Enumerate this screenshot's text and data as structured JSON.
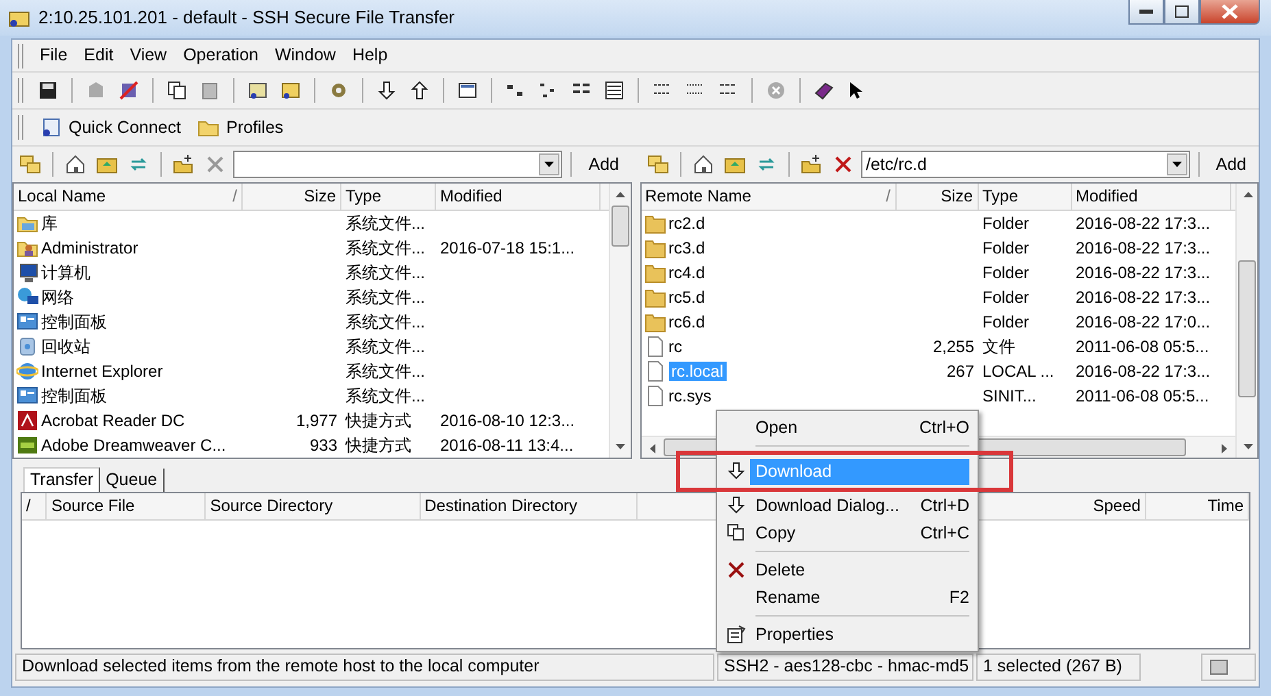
{
  "window": {
    "title": "2:10.25.101.201 - default - SSH Secure File Transfer"
  },
  "menu": [
    "File",
    "Edit",
    "View",
    "Operation",
    "Window",
    "Help"
  ],
  "quick_bar": [
    {
      "label": "Quick Connect",
      "kind": "connect"
    },
    {
      "label": "Profiles",
      "kind": "folder"
    }
  ],
  "local": {
    "add_button": "Add",
    "sort_mark": "/",
    "columns": [
      "Local Name",
      "Size",
      "Type",
      "Modified"
    ],
    "rows": [
      {
        "kind": "library",
        "name": "库",
        "type": "系统文件...",
        "selected": false
      },
      {
        "kind": "user",
        "name": "Administrator",
        "type": "系统文件...",
        "modified": "2016-07-18 15:1...",
        "selected": false
      },
      {
        "kind": "computer",
        "name": "计算机",
        "type": "系统文件...",
        "selected": false
      },
      {
        "kind": "network",
        "name": "网络",
        "type": "系统文件...",
        "selected": false
      },
      {
        "kind": "panel",
        "name": "控制面板",
        "type": "系统文件...",
        "selected": false
      },
      {
        "kind": "recycle",
        "name": "回收站",
        "type": "系统文件...",
        "selected": false
      },
      {
        "kind": "browser",
        "name": "Internet Explorer",
        "type": "系统文件...",
        "selected": false
      },
      {
        "kind": "panel",
        "name": "控制面板",
        "type": "系统文件...",
        "selected": false
      },
      {
        "kind": "pdf",
        "name": "Acrobat Reader DC",
        "size": "1,977",
        "type": "快捷方式",
        "modified": "2016-08-10 12:3...",
        "selected": false
      },
      {
        "kind": "dw",
        "name": "Adobe Dreamweaver C...",
        "size": "933",
        "type": "快捷方式",
        "modified": "2016-08-11 13:4...",
        "selected": false
      }
    ]
  },
  "remote": {
    "path": "/etc/rc.d",
    "add_button": "Add",
    "sort_mark": "/",
    "columns": [
      "Remote Name",
      "Size",
      "Type",
      "Modified"
    ],
    "rows": [
      {
        "kind": "folder",
        "name": "rc2.d",
        "type": "Folder",
        "modified": "2016-08-22 17:3...",
        "selected": false
      },
      {
        "kind": "folder",
        "name": "rc3.d",
        "type": "Folder",
        "modified": "2016-08-22 17:3...",
        "selected": false
      },
      {
        "kind": "folder",
        "name": "rc4.d",
        "type": "Folder",
        "modified": "2016-08-22 17:3...",
        "selected": false
      },
      {
        "kind": "folder",
        "name": "rc5.d",
        "type": "Folder",
        "modified": "2016-08-22 17:3...",
        "selected": false
      },
      {
        "kind": "folder",
        "name": "rc6.d",
        "type": "Folder",
        "modified": "2016-08-22 17:0...",
        "selected": false
      },
      {
        "kind": "file",
        "name": "rc",
        "size": "2,255",
        "type": "文件",
        "modified": "2011-06-08 05:5...",
        "selected": false
      },
      {
        "kind": "file",
        "name": "rc.local",
        "size": "267",
        "type": "LOCAL ...",
        "modified": "2016-08-22 17:3...",
        "selected": true
      },
      {
        "kind": "file",
        "name": "rc.sys",
        "type": "SINIT...",
        "modified": "2011-06-08 05:5...",
        "selected": false
      }
    ]
  },
  "context_menu": [
    {
      "kind": "plain",
      "label": "Open",
      "shortcut": "Ctrl+O",
      "selected": false,
      "outlined": false
    },
    {
      "kind": "separator"
    },
    {
      "kind": "arrow",
      "label": "Download",
      "selected": true,
      "outlined": true
    },
    {
      "kind": "arrow",
      "label": "Download Dialog...",
      "shortcut": "Ctrl+D",
      "selected": false,
      "outlined": false
    },
    {
      "kind": "copy",
      "label": "Copy",
      "shortcut": "Ctrl+C",
      "selected": false,
      "outlined": false
    },
    {
      "kind": "separator"
    },
    {
      "kind": "delete",
      "label": "Delete",
      "selected": false,
      "outlined": false
    },
    {
      "kind": "plain",
      "label": "Rename",
      "shortcut": "F2",
      "selected": false,
      "outlined": false
    },
    {
      "kind": "separator"
    },
    {
      "kind": "properties",
      "label": "Properties",
      "selected": false,
      "outlined": false
    }
  ],
  "transfer": {
    "tabs": [
      {
        "label": "Transfer",
        "selected": true
      },
      {
        "label": "Queue",
        "selected": false
      }
    ],
    "columns": [
      "/",
      "Source File",
      "Source Directory",
      "Destination Directory",
      "Speed",
      "Time"
    ]
  },
  "status_bar": {
    "message": "Download selected items from the remote host to the local computer",
    "connection": "SSH2 - aes128-cbc - hmac-md5",
    "selection": "1 selected (267 B)"
  }
}
